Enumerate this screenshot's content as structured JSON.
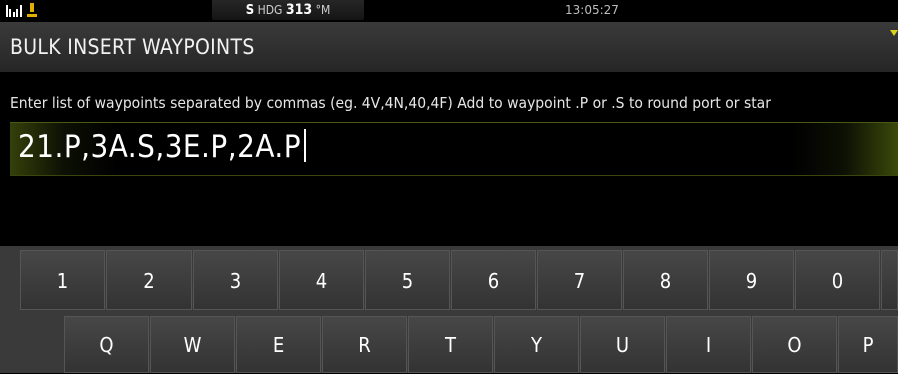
{
  "status_bar": {
    "hdg_prefix": "S",
    "hdg_label": "HDG",
    "hdg_value": "313",
    "hdg_unit": "°M",
    "time": "13:05:27"
  },
  "dialog": {
    "title": "BULK INSERT WAYPOINTS",
    "instructions": "Enter list of waypoints separated by commas (eg. 4V,4N,40,4F) Add to waypoint .P or .S to round port or star",
    "input_value": "21.P,3A.S,3E.P,2A.P"
  },
  "keyboard": {
    "row1": [
      "1",
      "2",
      "3",
      "4",
      "5",
      "6",
      "7",
      "8",
      "9",
      "0"
    ],
    "row2": [
      "Q",
      "W",
      "E",
      "R",
      "T",
      "Y",
      "U",
      "I",
      "O",
      "P"
    ]
  },
  "colors": {
    "accent": "#c8d21a",
    "title_bar": "#2e2e2e",
    "keyboard_bg": "#3a3a3a"
  }
}
